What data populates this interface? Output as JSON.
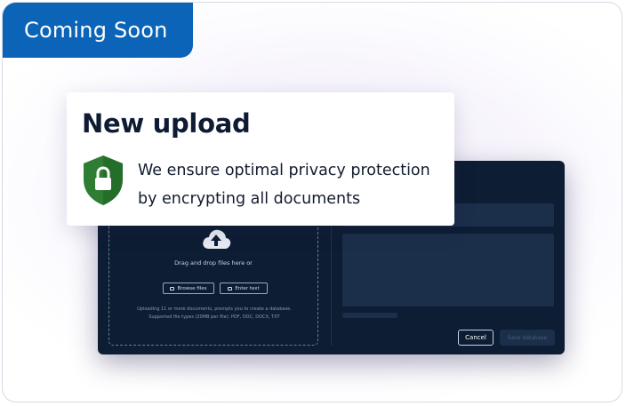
{
  "badge": {
    "label": "Coming Soon"
  },
  "upload_card": {
    "title": "New upload",
    "privacy_line1": "We ensure optimal privacy protection",
    "privacy_line2": "by encrypting all documents"
  },
  "modal": {
    "dropzone": {
      "drag_text": "Drag and drop files here or",
      "browse_label": "Browse files",
      "enter_text_label": "Enter text",
      "info_line1": "Uploading 11 or more documents, prompts you to create a database.",
      "info_line2": "Supported file types (20MB per file): PDF, DOC, DOCX, TXT"
    },
    "cancel_label": "Cancel",
    "save_label": "Save database"
  },
  "colors": {
    "badge": "#0b64b7",
    "modal_bg": "#0d1d33",
    "shield": "#2e7d32",
    "title": "#0e1b33"
  },
  "icons": [
    "upload-cloud-icon",
    "shield-lock-icon",
    "folder-icon",
    "text-icon"
  ]
}
